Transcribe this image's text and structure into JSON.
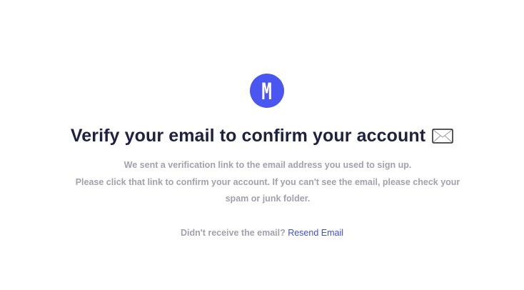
{
  "brand": {
    "logo_letter": "M",
    "accent_color": "#4a56f0"
  },
  "verify": {
    "title": "Verify your email to confirm your account",
    "title_icon": "envelope-icon",
    "message_lines": [
      "We sent a verification link to the email address you used to sign up.",
      "Please click that link to confirm your account. If you can't see the email, please check your",
      "spam or junk folder."
    ],
    "resend_prompt": "Didn't receive the email?",
    "resend_link": "Resend Email"
  }
}
